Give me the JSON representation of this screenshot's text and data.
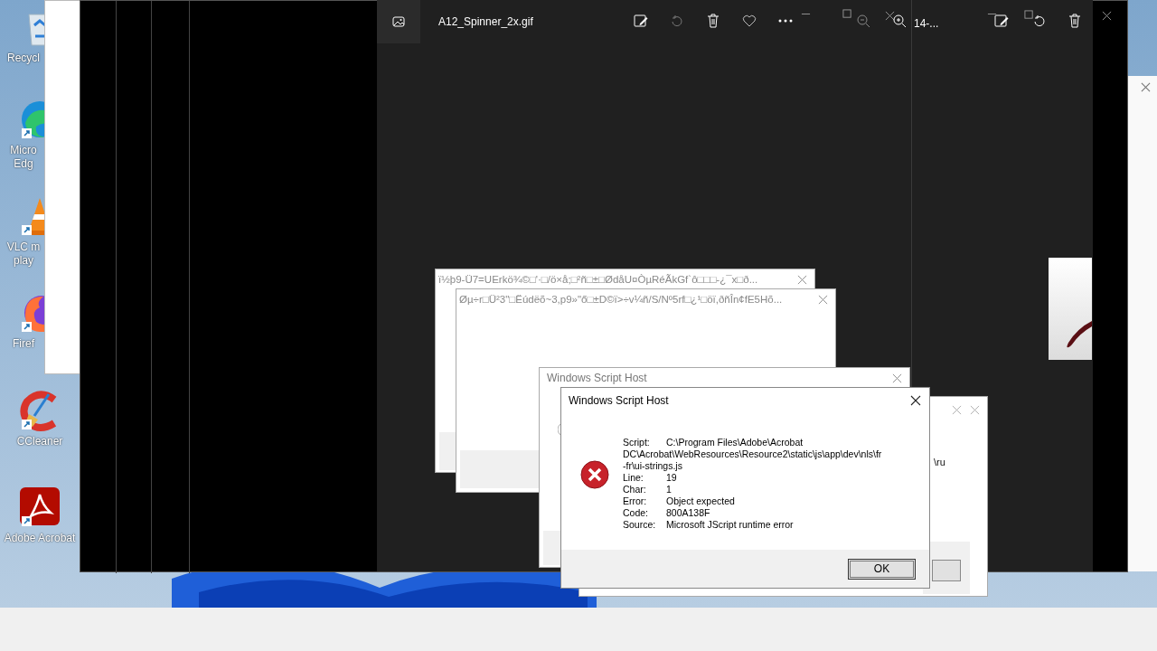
{
  "desktop_icons": [
    {
      "kind": "recycle",
      "label": "Recycl"
    },
    {
      "kind": "edge",
      "label": "Micro Edg"
    },
    {
      "kind": "vlc",
      "label": "VLC m play"
    },
    {
      "kind": "firefox",
      "label": "Firef"
    },
    {
      "kind": "ccleaner",
      "label": "CCleaner"
    },
    {
      "kind": "acrobat",
      "label": "Adobe Acrobat"
    }
  ],
  "photo_viewer": {
    "title": "A12_Spinner_2x.gif"
  },
  "photo_viewer_2": {
    "title": "14-..."
  },
  "dialogs_behind": [
    {
      "title": "ï½þ9-Ü7=UErkö¾©□'·□/ö×å;□²ñ□±□ØdåU¤ÒµRéÃkGf`ô□□□-¿¯x□ð..."
    },
    {
      "title": "Øµ÷r□Ü²3\"□Ëúdëõ~3,p9»\"ő□±D©ï>÷v¼ñ/S/Nº5rf□¿¹□öï,ðñÎn¢fE5Hõ..."
    },
    {
      "title": "Windows Script Host"
    }
  ],
  "partial_text": "\\ru",
  "error_dialog": {
    "title": "Windows Script Host",
    "fields": [
      {
        "label": "Script:",
        "value": "C:\\Program Files\\Adobe\\Acrobat",
        "continuation": [
          "DC\\Acrobat\\WebResources\\Resource2\\static\\js\\app\\dev\\nls\\fr",
          "-fr\\ui-strings.js"
        ]
      },
      {
        "label": "Line:",
        "value": "19"
      },
      {
        "label": "Char:",
        "value": "1"
      },
      {
        "label": "Error:",
        "value": "Object expected"
      },
      {
        "label": "Code:",
        "value": "800A138F"
      },
      {
        "label": "Source:",
        "value": "Microsoft JScript runtime error"
      }
    ],
    "button": "OK"
  }
}
